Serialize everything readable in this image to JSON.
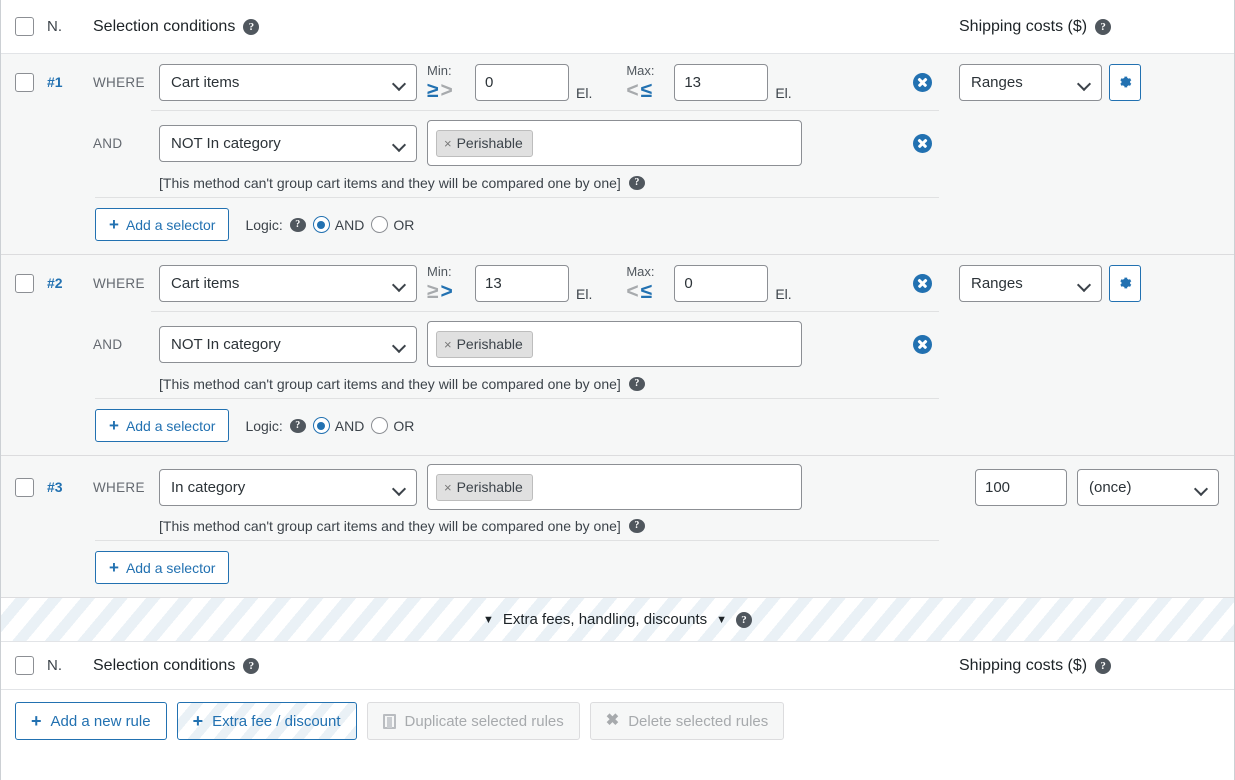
{
  "header": {
    "num_label": "N.",
    "title": "Selection conditions",
    "costs_title": "Shipping costs ($)",
    "help_glyph": "?"
  },
  "footer_header": {
    "num_label": "N.",
    "title": "Selection conditions",
    "costs_title": "Shipping costs ($)"
  },
  "labels": {
    "where": "WHERE",
    "and": "AND",
    "min": "Min:",
    "max": "Max:",
    "unit": "El.",
    "logic": "Logic:",
    "logic_and": "AND",
    "logic_or": "OR",
    "add_selector": "Add a selector",
    "plus": "+",
    "note": "[This method can't group cart items and they will be compared one by one]",
    "op_gte": "≥",
    "op_gt": ">",
    "op_lt": "<",
    "op_lte": "≤"
  },
  "rules": [
    {
      "number": "#1",
      "condition": "Cart items",
      "min_value": "0",
      "max_value": "13",
      "min_op_selected": "gte",
      "max_op_selected": "lte",
      "cost_mode": "Ranges",
      "second": {
        "joiner": "AND",
        "condition": "NOT In category",
        "tag": "Perishable"
      },
      "logic_selected": "AND"
    },
    {
      "number": "#2",
      "condition": "Cart items",
      "min_value": "13",
      "max_value": "0",
      "min_op_selected": "gt",
      "max_op_selected": "lte",
      "cost_mode": "Ranges",
      "second": {
        "joiner": "AND",
        "condition": "NOT In category",
        "tag": "Perishable"
      },
      "logic_selected": "AND"
    },
    {
      "number": "#3",
      "condition": "In category",
      "tag": "Perishable",
      "cost_value": "100",
      "cost_unit": "(once)"
    }
  ],
  "extra_bar": {
    "label": "Extra fees, handling, discounts",
    "caret_left": "▼",
    "caret_right": "▼"
  },
  "toolbar": {
    "add_rule": "Add a new rule",
    "extra_fee": "Extra fee / discount",
    "duplicate": "Duplicate selected rules",
    "delete": "Delete selected rules",
    "plus": "+",
    "x_glyph": "✖"
  },
  "colors": {
    "accent": "#2271b1",
    "row_bg": "#f6f7f7",
    "border": "#dcdcde",
    "muted": "#a7aaad"
  }
}
